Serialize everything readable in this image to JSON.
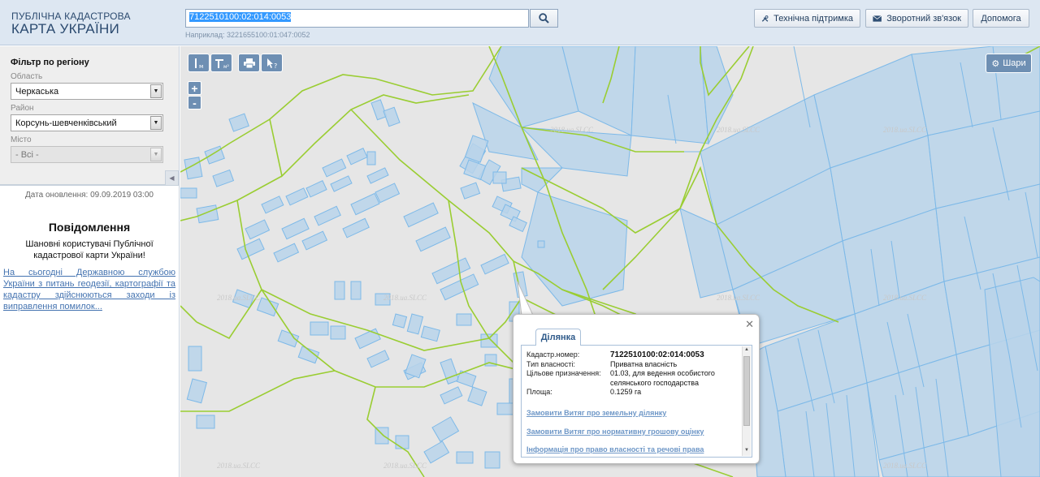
{
  "header": {
    "logo_line1": "ПУБЛІЧНА КАДАСТРОВА",
    "logo_line2": "КАРТА УКРАЇНИ",
    "search_value": "7122510100:02:014:0053",
    "search_hint": "Наприклад: 3221655100:01:047:0052",
    "buttons": {
      "support": "Технічна підтримка",
      "feedback": "Зворотний зв'язок",
      "help": "Допомога"
    }
  },
  "sidebar": {
    "filter_title": "Фільтр по регіону",
    "region_label": "Область",
    "region_value": "Черкаська",
    "district_label": "Район",
    "district_value": "Корсунь-шевченківський",
    "city_label": "Місто",
    "city_value": "- Всі -",
    "update_date": "Дата оновлення: 09.09.2019 03:00",
    "notice_title": "Повідомлення",
    "notice_body": "Шановні користувачі Публічної кадастрової карти України!",
    "notice_link": "На сьогодні Державною службою України з питань геодезії, картографії та кадастру здійснюються заходи із виправлення помилок..."
  },
  "map": {
    "layers_label": "Шари",
    "zoom_in": "+",
    "zoom_out": "-",
    "watermark": "2018.ua.SLCC",
    "colors": {
      "background": "#e6e6e6",
      "parcel_fill": "#b8d4ea",
      "parcel_stroke": "#7db9e8",
      "boundary": "#9acd32",
      "tool": "#6e8fb3"
    }
  },
  "popup": {
    "tab": "Ділянка",
    "rows": [
      {
        "label": "Кадастр.номер:",
        "value": "7122510100:02:014:0053"
      },
      {
        "label": "Тип власності:",
        "value": "Приватна власність"
      },
      {
        "label": "Цільове призначення:",
        "value": "01.03, для ведення особистого селянського господарства"
      },
      {
        "label": "Площа:",
        "value": "0.1259 га"
      }
    ],
    "links": [
      "Замовити Витяг про земельну ділянку",
      "Замовити Витяг про нормативну грошову оцінку",
      "Інформація про право власності та речові права"
    ]
  }
}
